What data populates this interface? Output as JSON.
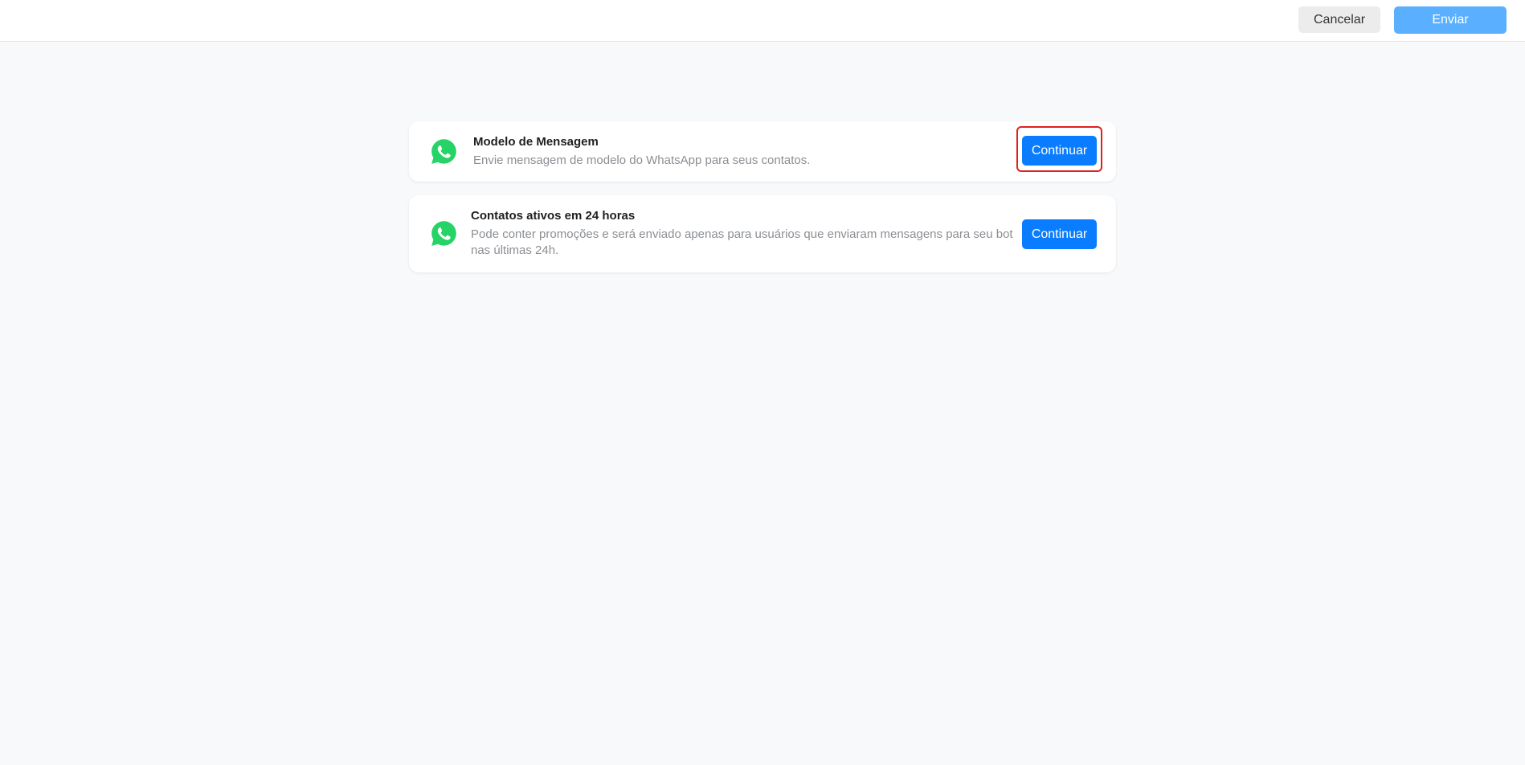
{
  "header": {
    "cancel_label": "Cancelar",
    "send_label": "Enviar"
  },
  "options": [
    {
      "title": "Modelo de Mensagem",
      "description": "Envie mensagem de modelo do WhatsApp para seus contatos.",
      "button_label": "Continuar",
      "icon": "whatsapp-icon",
      "highlighted": true
    },
    {
      "title": "Contatos ativos em 24 horas",
      "description": "Pode conter promoções e será enviado apenas para usuários que enviaram mensagens para seu bot nas últimas 24h.",
      "button_label": "Continuar",
      "icon": "whatsapp-icon",
      "highlighted": false
    }
  ],
  "colors": {
    "primary": "#0a7cff",
    "send_disabled": "#5ab0ff",
    "whatsapp": "#25d366",
    "highlight": "#e02020"
  }
}
